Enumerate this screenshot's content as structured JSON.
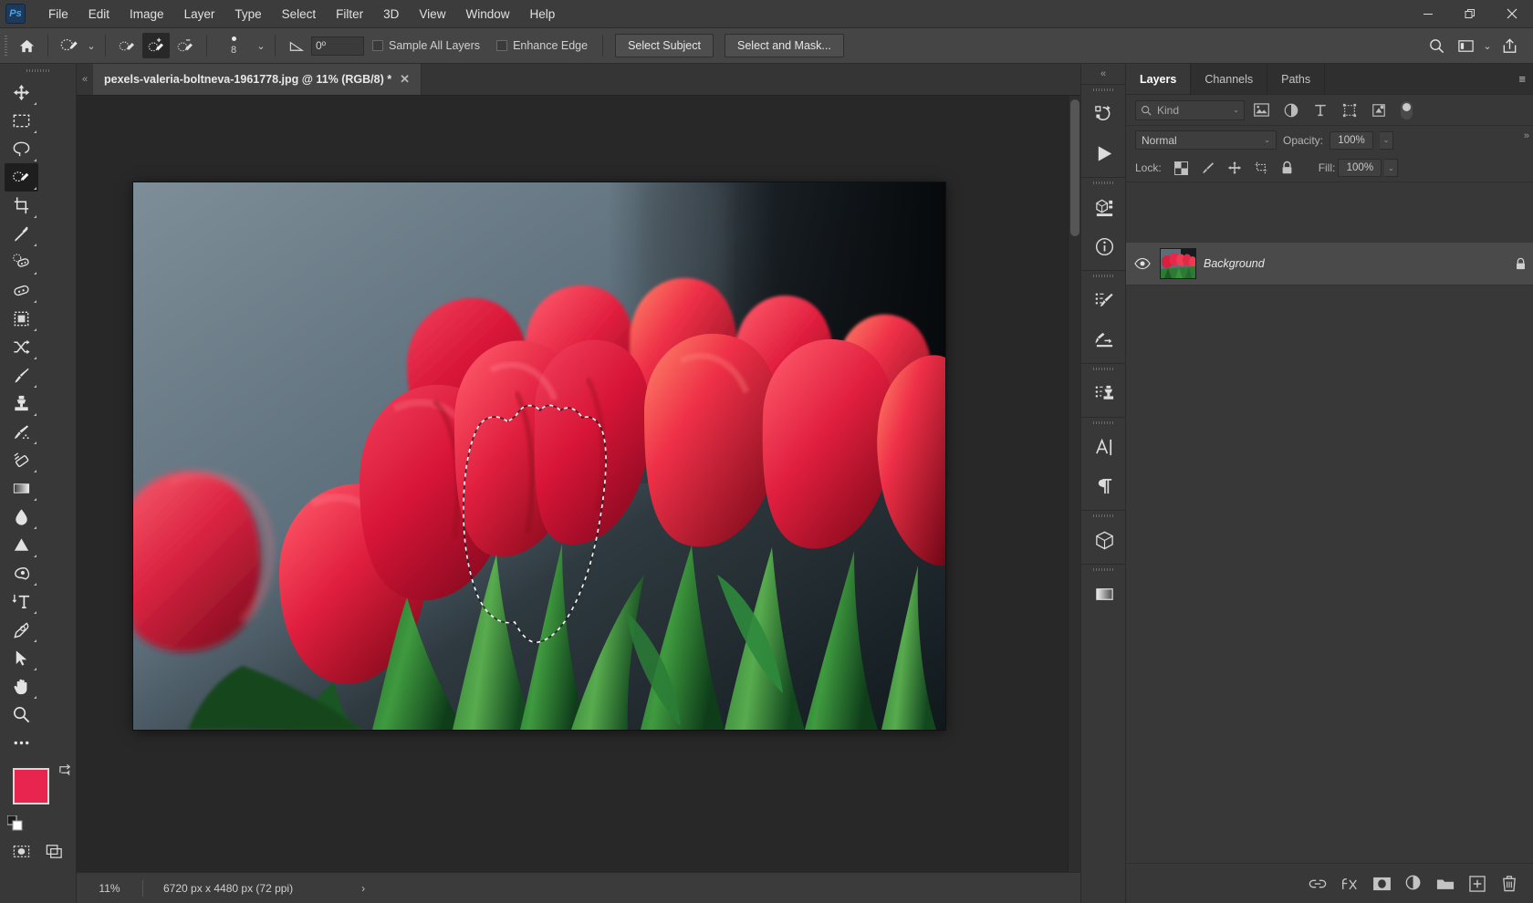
{
  "app": {
    "name": "Adobe Photoshop",
    "logo_text": "Ps"
  },
  "menubar": {
    "items": [
      {
        "label": "File"
      },
      {
        "label": "Edit"
      },
      {
        "label": "Image"
      },
      {
        "label": "Layer"
      },
      {
        "label": "Type"
      },
      {
        "label": "Select"
      },
      {
        "label": "Filter"
      },
      {
        "label": "3D"
      },
      {
        "label": "View"
      },
      {
        "label": "Window"
      },
      {
        "label": "Help"
      }
    ],
    "window_controls": {
      "minimize": "—",
      "restore": "❐",
      "close": "✕"
    }
  },
  "options_bar": {
    "home_icon": "home-icon",
    "tool_preset_icon": "quick-selection-preset-icon",
    "tool_preset_caret": "⌄",
    "modes": [
      {
        "name": "new-selection",
        "active": false
      },
      {
        "name": "add-to-selection",
        "active": true
      },
      {
        "name": "subtract-from-selection",
        "active": false
      }
    ],
    "brush_size": "8",
    "brush_caret": "⌄",
    "angle_icon": "angle-icon",
    "angle_value": "0º",
    "sample_all_layers": {
      "label": "Sample All Layers",
      "checked": false
    },
    "enhance_edge": {
      "label": "Enhance Edge",
      "checked": false
    },
    "select_subject": "Select Subject",
    "select_and_mask": "Select and Mask...",
    "right_icons": [
      "search-icon",
      "workspace-icon",
      "chevron-down-icon",
      "share-icon"
    ]
  },
  "toolbox": {
    "tools": [
      {
        "name": "move-tool",
        "active": false
      },
      {
        "name": "rectangular-marquee-tool",
        "active": false
      },
      {
        "name": "lasso-tool",
        "active": false
      },
      {
        "name": "quick-selection-tool",
        "active": true
      },
      {
        "name": "crop-tool",
        "active": false
      },
      {
        "name": "eyedropper-tool",
        "active": false
      },
      {
        "name": "spot-healing-brush-tool",
        "active": false
      },
      {
        "name": "patch-tool",
        "active": false
      },
      {
        "name": "frame-tool",
        "active": false
      },
      {
        "name": "shuffle-tool",
        "active": false
      },
      {
        "name": "brush-tool",
        "active": false
      },
      {
        "name": "clone-stamp-tool",
        "active": false
      },
      {
        "name": "history-brush-tool",
        "active": false
      },
      {
        "name": "eraser-tool",
        "active": false
      },
      {
        "name": "gradient-tool",
        "active": false
      },
      {
        "name": "blur-tool",
        "active": false
      },
      {
        "name": "dodge-tool",
        "active": false
      },
      {
        "name": "burn-tool",
        "active": false
      },
      {
        "name": "type-tool",
        "active": false
      },
      {
        "name": "pen-tool",
        "active": false
      },
      {
        "name": "path-selection-tool",
        "active": false
      },
      {
        "name": "hand-tool",
        "active": false
      },
      {
        "name": "zoom-tool",
        "active": false
      },
      {
        "name": "edit-toolbar-tool",
        "active": false
      }
    ],
    "foreground_color": "#e8254f",
    "background_color": "#ffffff",
    "swap_icon": "swap-colors-icon",
    "default_colors_icon": "default-colors-icon",
    "quick_mask_icon": "quick-mask-icon",
    "screen_mode_icon": "screen-mode-icon"
  },
  "document": {
    "tab_title": "pexels-valeria-boltneva-1961778.jpg @ 11% (RGB/8) *",
    "tab_close_icon": "✕",
    "collapse_icon": "«"
  },
  "statusbar": {
    "zoom": "11%",
    "dimensions": "6720 px x 4480 px (72 ppi)",
    "arrow": "›"
  },
  "icon_rail": {
    "collapse_icon": "«",
    "groups": [
      {
        "items": [
          {
            "name": "history-icon"
          },
          {
            "name": "actions-play-icon"
          }
        ]
      },
      {
        "items": [
          {
            "name": "3d-properties-icon"
          },
          {
            "name": "info-icon"
          }
        ]
      },
      {
        "items": [
          {
            "name": "brush-settings-icon"
          },
          {
            "name": "brush-presets-icon"
          }
        ]
      },
      {
        "items": [
          {
            "name": "clone-source-icon"
          }
        ]
      },
      {
        "items": [
          {
            "name": "character-icon"
          },
          {
            "name": "paragraph-icon"
          }
        ]
      },
      {
        "items": [
          {
            "name": "3d-cube-icon"
          }
        ]
      },
      {
        "items": [
          {
            "name": "gradients-icon"
          }
        ]
      }
    ]
  },
  "layers_panel": {
    "collapse_icon": "»",
    "tabs": [
      {
        "label": "Layers",
        "active": true
      },
      {
        "label": "Channels",
        "active": false
      },
      {
        "label": "Paths",
        "active": false
      }
    ],
    "panel_menu_icon": "≡",
    "filter": {
      "search_icon": "search-icon",
      "kind_label": "Kind",
      "caret": "⌄",
      "type_icons": [
        "pixel-layers-icon",
        "adjustment-layers-icon",
        "type-layers-icon",
        "shape-layers-icon",
        "smart-object-icon"
      ],
      "toggle_name": "filter-toggle"
    },
    "blend_mode": "Normal",
    "blend_caret": "⌄",
    "opacity_label": "Opacity:",
    "opacity_value": "100%",
    "lock_label": "Lock:",
    "lock_icons": [
      "lock-transparent-pixels-icon",
      "lock-image-pixels-icon",
      "lock-position-icon",
      "lock-artboard-icon",
      "lock-all-icon"
    ],
    "fill_label": "Fill:",
    "fill_value": "100%",
    "layers": [
      {
        "name": "Background",
        "visible": true,
        "locked": true,
        "eye_icon": "eye-icon",
        "lock_icon": "lock-icon",
        "thumbnail": "tulips-thumbnail"
      }
    ],
    "footer_icons": [
      {
        "name": "link-layers-icon"
      },
      {
        "name": "layer-style-fx-icon"
      },
      {
        "name": "add-layer-mask-icon"
      },
      {
        "name": "new-adjustment-layer-icon"
      },
      {
        "name": "new-group-icon"
      },
      {
        "name": "new-layer-icon"
      },
      {
        "name": "delete-layer-icon"
      }
    ]
  },
  "canvas": {
    "image_description": "red-tulips-photo",
    "selection_name": "marching-ants-selection"
  }
}
